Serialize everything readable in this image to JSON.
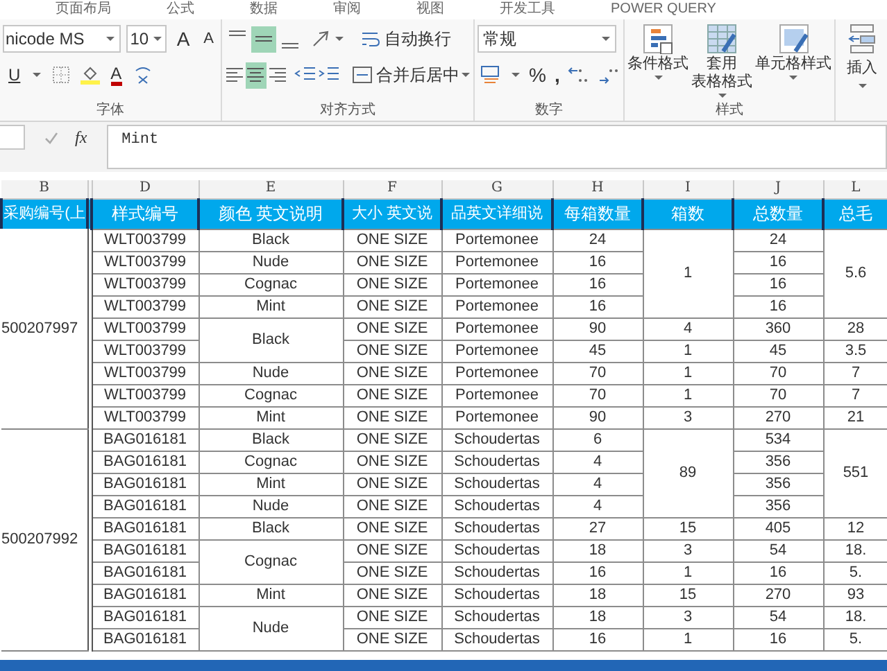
{
  "ribbon_tabs": [
    {
      "label": "页面布局"
    },
    {
      "label": "公式"
    },
    {
      "label": "数据"
    },
    {
      "label": "审阅"
    },
    {
      "label": "视图"
    },
    {
      "label": "开发工具"
    },
    {
      "label": "POWER QUERY"
    }
  ],
  "ribbon": {
    "font_group": {
      "label": "字体",
      "font_name": "nicode MS",
      "font_size": "10",
      "grow": "A",
      "shrink": "A",
      "underline": "U",
      "font_color": "A"
    },
    "alignment_group": {
      "label": "对齐方式",
      "vertical_align": [
        {
          "kind": "top",
          "selected": false
        },
        {
          "kind": "middle",
          "selected": true
        },
        {
          "kind": "bottom",
          "selected": false
        }
      ],
      "horizontal_align": [
        {
          "kind": "left",
          "selected": false
        },
        {
          "kind": "center",
          "selected": true
        },
        {
          "kind": "right",
          "selected": false
        }
      ],
      "wrap_text": "自动换行",
      "merge_center": "合并后居中"
    },
    "number_group": {
      "label": "数字",
      "format": "常规",
      "percent": "%",
      "comma": ","
    },
    "styles_group": {
      "label": "样式",
      "buttons": [
        {
          "kind": "conditional",
          "lines": [
            "条件格式"
          ]
        },
        {
          "kind": "table",
          "lines": [
            "套用",
            "表格格式"
          ]
        },
        {
          "kind": "cell",
          "lines": [
            "单元格样式"
          ]
        }
      ]
    },
    "insert_button": "插入"
  },
  "formula_bar": {
    "function_label": "fx",
    "value": "Mint"
  },
  "table": {
    "columns": [
      {
        "letter": "B",
        "header": "采购编号(上"
      },
      {
        "letter": "D",
        "header": "样式编号"
      },
      {
        "letter": "E",
        "header": "颜色 英文说明"
      },
      {
        "letter": "F",
        "header": "大小 英文说"
      },
      {
        "letter": "G",
        "header": "品英文详细说"
      },
      {
        "letter": "H",
        "header": "每箱数量"
      },
      {
        "letter": "I",
        "header": "箱数"
      },
      {
        "letter": "J",
        "header": "总数量"
      },
      {
        "letter": "L",
        "header": "总毛"
      }
    ],
    "groups": [
      {
        "po_number": "500207997",
        "rows": [
          {
            "style": "WLT003799",
            "color_name": "Black",
            "size": "ONE SIZE",
            "description": "Portemonee",
            "per_box": "24",
            "boxes": "1",
            "total": "24",
            "gross": "5.6"
          },
          {
            "style": "WLT003799",
            "color_name": "Nude",
            "size": "ONE SIZE",
            "description": "Portemonee",
            "per_box": "16",
            "total": "16"
          },
          {
            "style": "WLT003799",
            "color_name": "Cognac",
            "size": "ONE SIZE",
            "description": "Portemonee",
            "per_box": "16",
            "total": "16"
          },
          {
            "style": "WLT003799",
            "color_name": "Mint",
            "size": "ONE SIZE",
            "description": "Portemonee",
            "per_box": "16",
            "total": "16"
          },
          {
            "style": "WLT003799",
            "color_name": "Black",
            "size": "ONE SIZE",
            "description": "Portemonee",
            "per_box": "90",
            "boxes": "4",
            "total": "360",
            "gross": "28"
          },
          {
            "style": "WLT003799",
            "size": "ONE SIZE",
            "description": "Portemonee",
            "per_box": "45",
            "boxes": "1",
            "total": "45",
            "gross": "3.5"
          },
          {
            "style": "WLT003799",
            "color_name": "Nude",
            "size": "ONE SIZE",
            "description": "Portemonee",
            "per_box": "70",
            "boxes": "1",
            "total": "70",
            "gross": "7"
          },
          {
            "style": "WLT003799",
            "color_name": "Cognac",
            "size": "ONE SIZE",
            "description": "Portemonee",
            "per_box": "70",
            "boxes": "1",
            "total": "70",
            "gross": "7"
          },
          {
            "style": "WLT003799",
            "color_name": "Mint",
            "size": "ONE SIZE",
            "description": "Portemonee",
            "per_box": "90",
            "boxes": "3",
            "total": "270",
            "gross": "21"
          }
        ]
      },
      {
        "po_number": "500207992",
        "rows": [
          {
            "style": "BAG016181",
            "color_name": "Black",
            "size": "ONE SIZE",
            "description": "Schoudertas",
            "per_box": "6",
            "boxes": "89",
            "total": "534",
            "gross": "551"
          },
          {
            "style": "BAG016181",
            "color_name": "Cognac",
            "size": "ONE SIZE",
            "description": "Schoudertas",
            "per_box": "4",
            "total": "356"
          },
          {
            "style": "BAG016181",
            "color_name": "Mint",
            "size": "ONE SIZE",
            "description": "Schoudertas",
            "per_box": "4",
            "total": "356"
          },
          {
            "style": "BAG016181",
            "color_name": "Nude",
            "size": "ONE SIZE",
            "description": "Schoudertas",
            "per_box": "4",
            "total": "356"
          },
          {
            "style": "BAG016181",
            "color_name": "Black",
            "size": "ONE SIZE",
            "description": "Schoudertas",
            "per_box": "27",
            "boxes": "15",
            "total": "405",
            "gross": "12"
          },
          {
            "style": "BAG016181",
            "color_name": "Cognac",
            "size": "ONE SIZE",
            "description": "Schoudertas",
            "per_box": "18",
            "boxes": "3",
            "total": "54",
            "gross": "18."
          },
          {
            "style": "BAG016181",
            "size": "ONE SIZE",
            "description": "Schoudertas",
            "per_box": "16",
            "boxes": "1",
            "total": "16",
            "gross": "5."
          },
          {
            "style": "BAG016181",
            "color_name": "Mint",
            "size": "ONE SIZE",
            "description": "Schoudertas",
            "per_box": "18",
            "boxes": "15",
            "total": "270",
            "gross": "93"
          },
          {
            "style": "BAG016181",
            "color_name": "Nude",
            "size": "ONE SIZE",
            "description": "Schoudertas",
            "per_box": "18",
            "boxes": "3",
            "total": "54",
            "gross": "18."
          },
          {
            "style": "BAG016181",
            "size": "ONE SIZE",
            "description": "Schoudertas",
            "per_box": "16",
            "boxes": "1",
            "total": "16",
            "gross": "5."
          }
        ]
      }
    ]
  }
}
